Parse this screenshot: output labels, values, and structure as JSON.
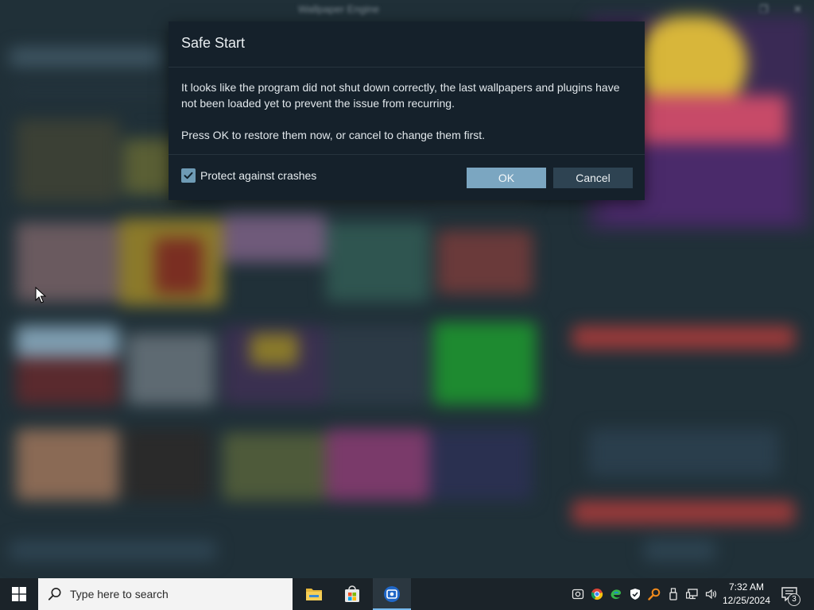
{
  "background_app": {
    "title": "Wallpaper Engine"
  },
  "dialog": {
    "title": "Safe Start",
    "message_1": "It looks like the program did not shut down correctly, the last wallpapers and plugins have not been loaded yet to prevent the issue from recurring.",
    "message_2": "Press OK to restore them now, or cancel to change them first.",
    "checkbox_label": "Protect against crashes",
    "checkbox_checked": true,
    "ok_label": "OK",
    "cancel_label": "Cancel",
    "colors": {
      "background": "#15212b",
      "ok_button": "#7ba6c1",
      "cancel_button": "#2e4352",
      "checkbox": "#6e9bb5"
    }
  },
  "taskbar": {
    "start_icon": "windows-logo-icon",
    "search_placeholder": "Type here to search",
    "pinned_apps": [
      "file-explorer-icon",
      "microsoft-store-icon",
      "wallpaper-engine-icon"
    ],
    "tray_icons": [
      "steam-icon",
      "chrome-icon",
      "edge-icon",
      "shield-icon",
      "magnifier-icon",
      "usb-icon",
      "network-icon",
      "volume-icon"
    ],
    "clock_time": "7:32 AM",
    "clock_date": "12/25/2024",
    "notification_count": "3"
  }
}
